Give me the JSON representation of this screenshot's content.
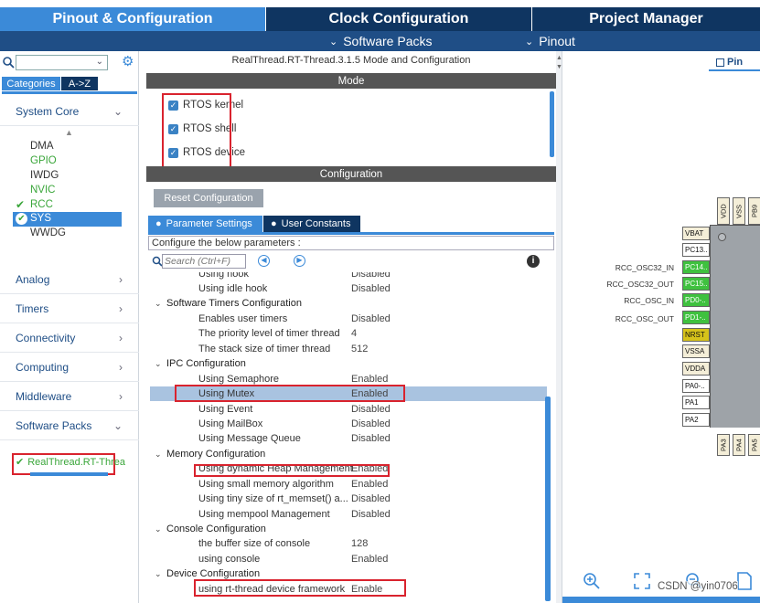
{
  "tabs": [
    {
      "label": "Pinout & Configuration"
    },
    {
      "label": "Clock Configuration"
    },
    {
      "label": "Project Manager"
    }
  ],
  "subbar": {
    "software_packs": "Software Packs",
    "pinout": "Pinout"
  },
  "left": {
    "tab_categories": "Categories",
    "tab_az": "A->Z",
    "categories": [
      {
        "label": "System Core"
      },
      {
        "label": "Analog"
      },
      {
        "label": "Timers"
      },
      {
        "label": "Connectivity"
      },
      {
        "label": "Computing"
      },
      {
        "label": "Middleware"
      },
      {
        "label": "Software Packs"
      }
    ],
    "system_core_items": [
      "DMA",
      "GPIO",
      "IWDG",
      "NVIC",
      "RCC",
      "SYS",
      "WWDG"
    ],
    "pack_item": "RealThread.RT-Threa"
  },
  "mid": {
    "title": "RealThread.RT-Thread.3.1.5 Mode and Configuration",
    "mode_header": "Mode",
    "modes": [
      "RTOS kernel",
      "RTOS shell",
      "RTOS device"
    ],
    "config_header": "Configuration",
    "reset_button": "Reset Configuration",
    "tab_params": "Parameter Settings",
    "tab_constants": "User Constants",
    "hint": "Configure the below parameters :",
    "search_placeholder": "Search (Ctrl+F)",
    "rows": [
      {
        "name": "Using hook",
        "value": "Disabled"
      },
      {
        "name": "Using idle hook",
        "value": "Disabled"
      },
      {
        "name": "Software Timers Configuration",
        "value": ""
      },
      {
        "name": "Enables user timers",
        "value": "Disabled"
      },
      {
        "name": "The priority level of timer thread",
        "value": "4"
      },
      {
        "name": "The stack size of timer thread",
        "value": "512"
      },
      {
        "name": "IPC Configuration",
        "value": ""
      },
      {
        "name": "Using Semaphore",
        "value": "Enabled"
      },
      {
        "name": "Using Mutex",
        "value": "Enabled"
      },
      {
        "name": "Using Event",
        "value": "Disabled"
      },
      {
        "name": "Using MailBox",
        "value": "Disabled"
      },
      {
        "name": "Using Message Queue",
        "value": "Disabled"
      },
      {
        "name": "Memory Configuration",
        "value": ""
      },
      {
        "name": "Using dynamic Heap Management",
        "value": "Enabled"
      },
      {
        "name": "Using small memory algorithm",
        "value": "Enabled"
      },
      {
        "name": "Using tiny size of rt_memset() a...",
        "value": "Disabled"
      },
      {
        "name": "Using mempool Management",
        "value": "Disabled"
      },
      {
        "name": "Console Configuration",
        "value": ""
      },
      {
        "name": "the buffer size of console",
        "value": "128"
      },
      {
        "name": "using console",
        "value": "Enabled"
      },
      {
        "name": "Device Configuration",
        "value": ""
      },
      {
        "name": "using rt-thread device framework",
        "value": "Enable"
      }
    ]
  },
  "right": {
    "view_label": "Pin",
    "top_pins": [
      "VDD",
      "VSS",
      "PB9"
    ],
    "left_labels": [
      "RCC_OSC32_IN",
      "RCC_OSC32_OUT",
      "RCC_OSC_IN",
      "RCC_OSC_OUT"
    ],
    "pins": [
      "VBAT",
      "PC13..",
      "PC14..",
      "PC15..",
      "PD0-..",
      "PD1-..",
      "NRST",
      "VSSA",
      "VDDA",
      "PA0-..",
      "PA1",
      "PA2"
    ],
    "bottom_pins": [
      "PA3",
      "PA4",
      "PA5"
    ],
    "watermark": "CSDN @yin0706"
  },
  "colors": {
    "accent": "#1f4e86",
    "tab_active": "#3b8ad8",
    "pin_green": "#3fc13f",
    "highlight_red": "#d9232e"
  }
}
